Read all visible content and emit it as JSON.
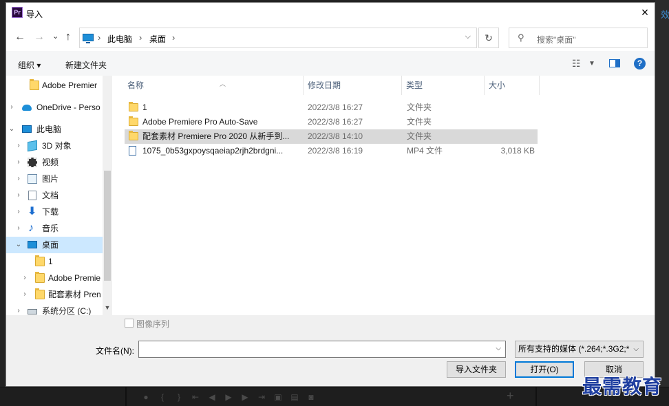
{
  "background_app": {
    "right_tab_label": "效"
  },
  "watermark": "最需教育",
  "dialog": {
    "title": "导入",
    "app_icon_text": "Pr",
    "close_glyph": "×"
  },
  "nav": {
    "back": "←",
    "forward": "→",
    "recent": "⌄",
    "up": "↑",
    "breadcrumbs": [
      "此电脑",
      "桌面"
    ],
    "refresh": "↻",
    "search_placeholder": "搜索\"桌面\""
  },
  "toolbar": {
    "organize": "组织 ▾",
    "new_folder": "新建文件夹",
    "help": "?"
  },
  "sidebar": {
    "items": [
      {
        "label": "Adobe Premier",
        "icon": "folder-icon",
        "arrow": ""
      },
      {
        "label": "OneDrive - Perso",
        "icon": "onedrive-icon",
        "arrow": "›"
      },
      {
        "label": "此电脑",
        "icon": "computer-icon",
        "arrow": "⌄"
      },
      {
        "label": "3D 对象",
        "icon": "3d-objects-icon",
        "arrow": "›"
      },
      {
        "label": "视频",
        "icon": "video-icon",
        "arrow": "›"
      },
      {
        "label": "图片",
        "icon": "picture-icon",
        "arrow": "›"
      },
      {
        "label": "文档",
        "icon": "document-icon",
        "arrow": "›"
      },
      {
        "label": "下载",
        "icon": "download-icon",
        "arrow": "›"
      },
      {
        "label": "音乐",
        "icon": "music-icon",
        "arrow": "›"
      },
      {
        "label": "桌面",
        "icon": "desktop-icon",
        "arrow": "⌄"
      },
      {
        "label": "1",
        "icon": "folder-icon",
        "arrow": ""
      },
      {
        "label": "Adobe Premie",
        "icon": "folder-icon",
        "arrow": "›"
      },
      {
        "label": "配套素材 Pren",
        "icon": "folder-icon",
        "arrow": "›"
      },
      {
        "label": "系统分区 (C:)",
        "icon": "drive-icon",
        "arrow": "›"
      }
    ]
  },
  "columns": [
    "名称",
    "修改日期",
    "类型",
    "大小"
  ],
  "files": [
    {
      "name": "1",
      "date": "2022/3/8 16:27",
      "type": "文件夹",
      "size": ""
    },
    {
      "name": "Adobe Premiere Pro Auto-Save",
      "date": "2022/3/8 16:27",
      "type": "文件夹",
      "size": ""
    },
    {
      "name": "配套素材 Premiere Pro 2020 从新手到...",
      "date": "2022/3/8 14:10",
      "type": "文件夹",
      "size": ""
    },
    {
      "name": "1075_0b53gxpoysqaeiap2rjh2brdgni...",
      "date": "2022/3/8 16:19",
      "type": "MP4 文件",
      "size": "3,018 KB"
    }
  ],
  "bottom": {
    "image_sequence_label": "图像序列",
    "filename_label": "文件名(N):",
    "filename_value": "",
    "file_type_selected": "所有支持的媒体 (*.264;*.3G2;*",
    "import_folder_button": "导入文件夹",
    "open_button": "打开(O)",
    "cancel_button": "取消"
  }
}
